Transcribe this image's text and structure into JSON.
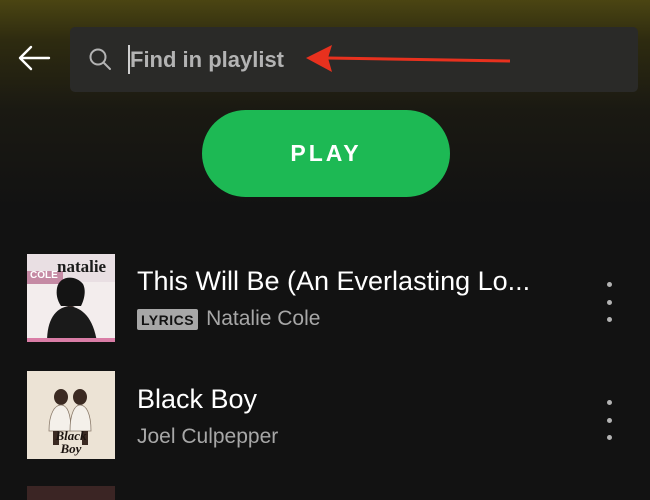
{
  "search": {
    "placeholder": "Find in playlist"
  },
  "actions": {
    "play_label": "PLAY"
  },
  "tracks": [
    {
      "title": "This Will Be (An Everlasting Lo...",
      "badge": "LYRICS",
      "artist": "Natalie Cole",
      "album_art_text_top": "natalie",
      "album_art_text_mid": "COLE"
    },
    {
      "title": "Black Boy",
      "artist": "Joel Culpepper",
      "album_art_text": "Black Boy"
    }
  ],
  "colors": {
    "accent": "#1db954",
    "background": "#121212",
    "search_bg": "#2a2a28",
    "annotation_arrow": "#e8311e"
  },
  "icons": {
    "back": "arrow-left-icon",
    "search": "search-icon",
    "more": "more-vertical-icon"
  }
}
